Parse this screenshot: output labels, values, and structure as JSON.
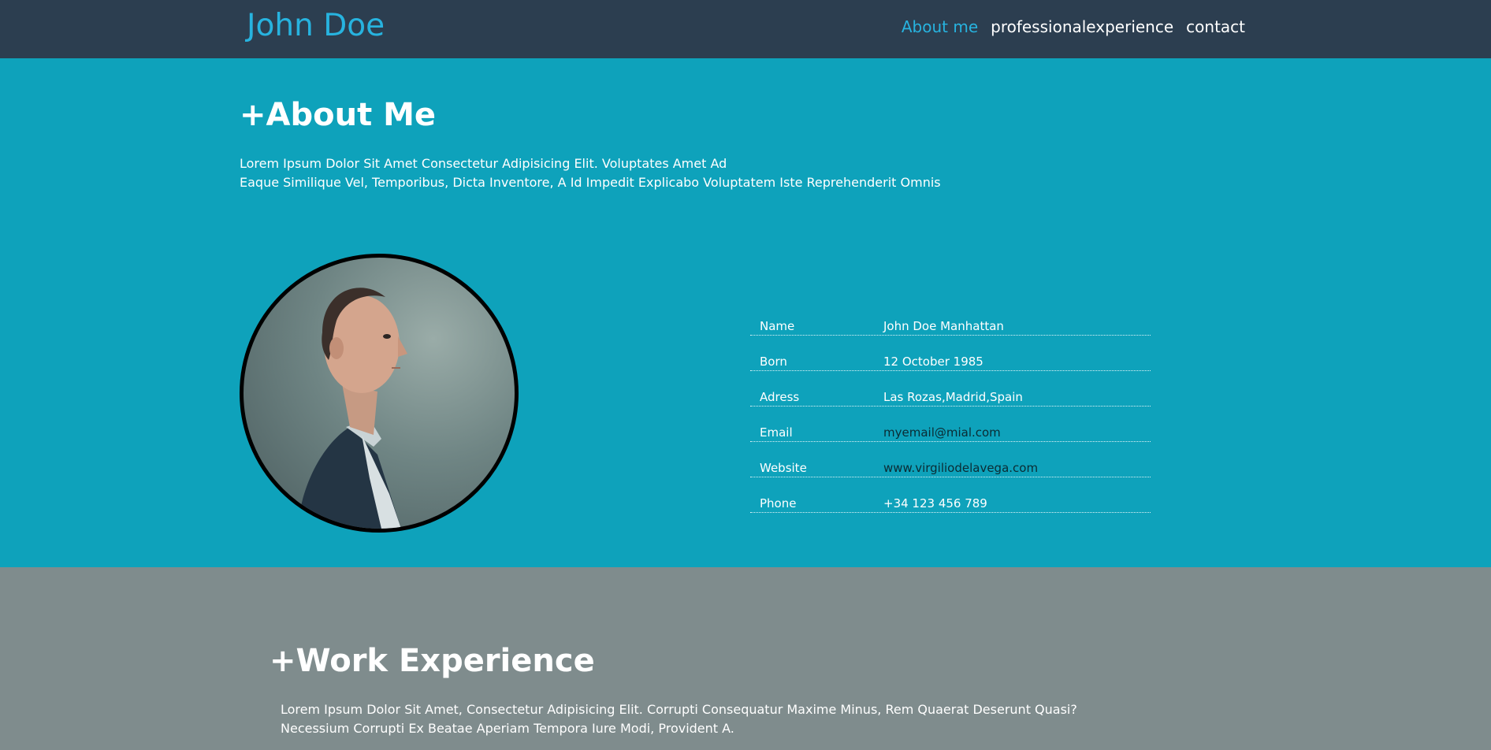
{
  "navbar": {
    "brand": "John Doe",
    "links": [
      {
        "label": "About me"
      },
      {
        "label": "professionalexperience"
      },
      {
        "label": "contact"
      }
    ],
    "active_color": "#27b3df",
    "background": "#2c3e50"
  },
  "about": {
    "title": "+About Me",
    "intro_line1": "Lorem Ipsum Dolor Sit Amet Consectetur Adipisicing Elit. Voluptates Amet Ad",
    "intro_line2": "Eaque Similique Vel, Temporibus, Dicta Inventore, A Id Impedit Explicabo Voluptatem Iste Reprehenderit Omnis",
    "background": "#0ea2bb",
    "info": [
      {
        "label": "Name",
        "value": "John Doe Manhattan"
      },
      {
        "label": "Born",
        "value": "12 October 1985"
      },
      {
        "label": "Adress",
        "value": "Las Rozas,Madrid,Spain"
      },
      {
        "label": "Email",
        "value": "myemail@mial.com"
      },
      {
        "label": "Website",
        "value": "www.virgiliodelavega.com"
      },
      {
        "label": "Phone",
        "value": "+34 123 456 789"
      }
    ]
  },
  "work": {
    "title": "+Work Experience",
    "intro_line1": "Lorem Ipsum Dolor Sit Amet, Consectetur Adipisicing Elit. Corrupti Consequatur Maxime Minus, Rem Quaerat Deserunt Quasi?",
    "intro_line2": "Necessium Corrupti Ex Beatae Aperiam Tempora Iure Modi, Provident A.",
    "background": "#7f8c8d"
  }
}
